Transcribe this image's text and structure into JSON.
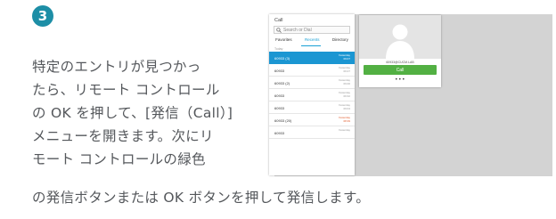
{
  "step": {
    "number": "3"
  },
  "instructions": {
    "lines": [
      "特定のエントリが見つかっ",
      "たら、リモート コントロール",
      "の OK を押して、[発信（Call）]",
      "メニューを開きます。次にリ",
      "モート コントロールの緑色",
      "の発信ボタンまたは OK ボタンを押して発信します。"
    ]
  },
  "call_panel": {
    "title": "Call",
    "search_placeholder": "Search or Dial",
    "tabs": [
      "Favorites",
      "Recents",
      "Directory"
    ],
    "active_tab": "Recents",
    "list_header": "Today",
    "recents": [
      {
        "name": "60933 (3)",
        "date": "Yesterday\n09:07",
        "selected": true,
        "missed": false
      },
      {
        "name": "60933",
        "date": "Yesterday\n09:27",
        "selected": false,
        "missed": false
      },
      {
        "name": "60933 (2)",
        "date": "Yesterday\n09:00",
        "selected": false,
        "missed": false
      },
      {
        "name": "60933",
        "date": "Yesterday\n09:32",
        "selected": false,
        "missed": false
      },
      {
        "name": "60933",
        "date": "Yesterday\n09:04",
        "selected": false,
        "missed": false
      },
      {
        "name": "60933 (20)",
        "date": "Yesterday\n08:39",
        "selected": false,
        "missed": true
      },
      {
        "name": "60933",
        "date": "Yesterday",
        "selected": false,
        "missed": false
      }
    ]
  },
  "contact_card": {
    "number": "60933@CUCM.LAB",
    "call_label": "Call",
    "more_label": "•••"
  },
  "colors": {
    "badge": "#1d8ea6",
    "text": "#55585c",
    "selection": "#1b96d2",
    "active_tab": "#1aa1d6",
    "call_button": "#52b043",
    "missed": "#e05a2b"
  }
}
